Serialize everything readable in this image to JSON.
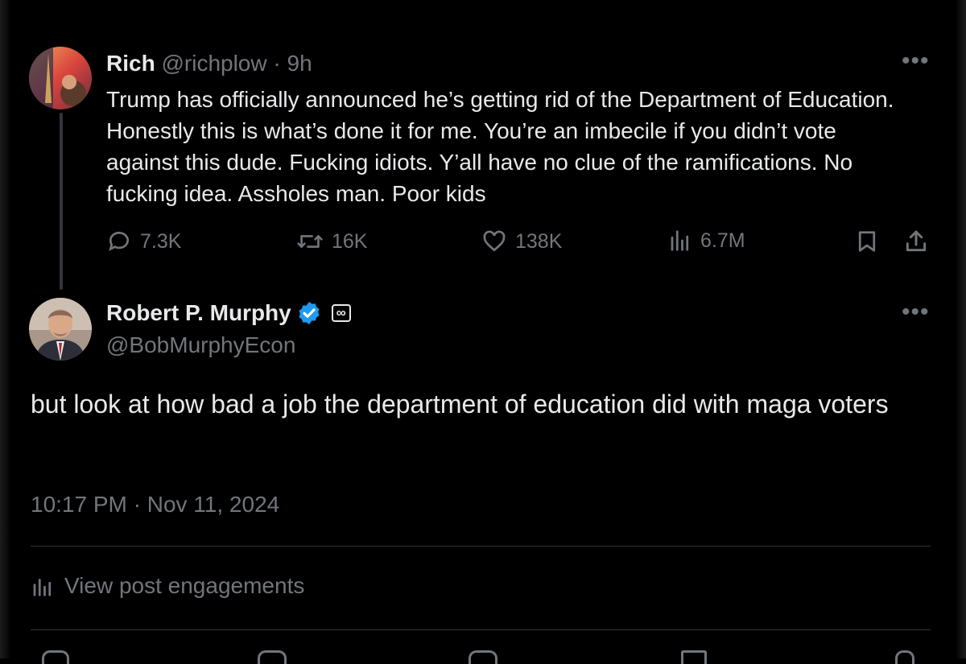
{
  "parent_post": {
    "display_name": "Rich",
    "handle": "@richplow",
    "separator": "·",
    "time": "9h",
    "text": "Trump has officially announced he’s getting rid of the Department of Education. Honestly this is what’s done it for me. You’re an imbecile if you didn’t vote against this dude. Fucking idiots. Y’all have no clue of the ramifications. No fucking idea. Assholes man. Poor kids",
    "more_icon": "•••",
    "stats": {
      "replies": "7.3K",
      "reposts": "16K",
      "likes": "138K",
      "views": "6.7M"
    }
  },
  "main_post": {
    "display_name": "Robert P. Murphy",
    "verified": true,
    "affiliate_badge": "∞",
    "handle": "@BobMurphyEcon",
    "more_icon": "•••",
    "text": "but look at how bad a job the department of education did with maga voters",
    "timestamp": "10:17 PM · Nov 11, 2024",
    "engagements_label": "View post engagements"
  },
  "colors": {
    "background": "#000000",
    "text_primary": "#e7e9ea",
    "text_muted": "#71767b",
    "verified_blue": "#1d9bf0",
    "divider": "#2f3336"
  },
  "icons": [
    "reply-icon",
    "repost-icon",
    "like-icon",
    "views-icon",
    "bookmark-icon",
    "share-icon",
    "verified-badge-icon",
    "analytics-icon"
  ]
}
